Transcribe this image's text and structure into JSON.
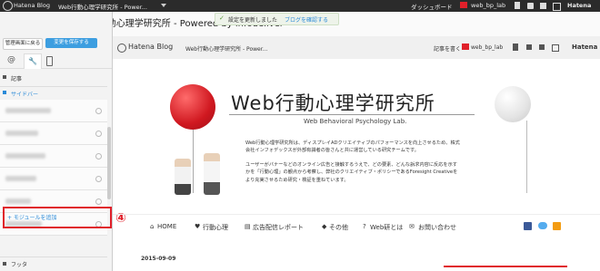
{
  "topbar": {
    "brand": "Hatena Blog",
    "tab_title": "Web行動心理学研究所 - Power...",
    "user": "web_bp_lab",
    "right_brand": "Hatena"
  },
  "dashboard_tab": "ダッシュボード",
  "page_title": "Web行動心理学研究所 - Powered by infodeliver",
  "notice": {
    "text": "設定を更新しました",
    "link": "ブログを確認する"
  },
  "sidebar": {
    "back_button": "管理画面に戻る",
    "save_button": "変更を保存する",
    "section_article": "記事",
    "section_sidebar": "サイドバー",
    "add_module": "+ モジュールを追加",
    "footer_section": "フッタ",
    "annotation": "④"
  },
  "blogbar": {
    "brand": "Hatena Blog",
    "title": "Web行動心理学研究所 - Power...",
    "write": "記事を書く",
    "user": "web_bp_lab",
    "right_brand": "Hatena"
  },
  "hero": {
    "title": "Web行動心理学研究所",
    "subtitle": "Web Behavioral Psychology Lab.",
    "para1": "Web行動心理学研究所は、ディスプレイADクリエイティブのパフォーマンスを向上させるため、株式会社インフォデックスが外部有識者の皆さんと共に運営している研究チームです。",
    "para2": "ユーザーがバナーなどのオンライン広告と接触するうえで、どの要素、どんな訴求内容に反応を示すかを「行動心理」の観点から考察し、弊社のクリエイティブ・ポリシーであるForesight Creativeをより充実させるため研究・検証を重ねています。"
  },
  "nav": {
    "items": [
      "HOME",
      "行動心理",
      "広告配信レポート",
      "その他",
      "Web研とは",
      "お問い合わせ"
    ]
  },
  "post_date": "2015-09-09",
  "colors": {
    "accent_red": "#e0202a",
    "save_blue": "#3d9ee0",
    "sidebar_link_blue": "#2a8ad8"
  }
}
